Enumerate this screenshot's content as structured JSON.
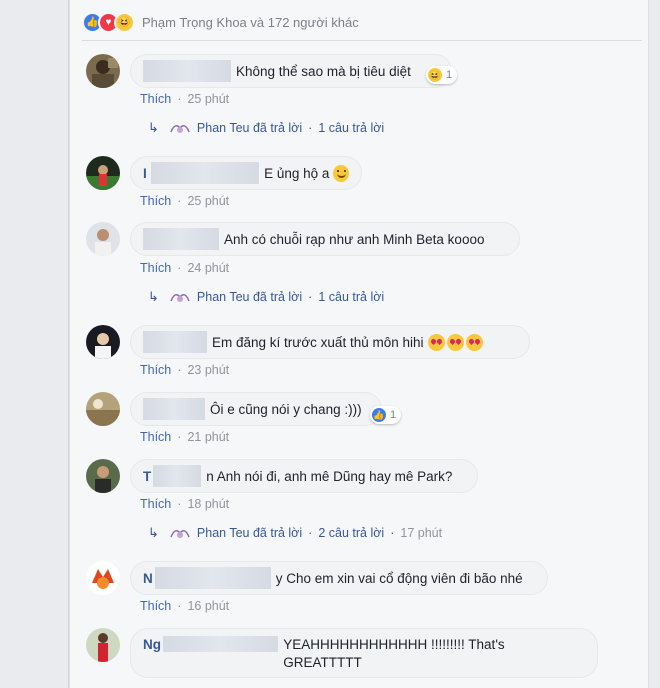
{
  "reactions": {
    "names": "Phạm Trọng Khoa và 172 người khác",
    "icons": [
      "like-icon",
      "love-icon",
      "haha-icon"
    ]
  },
  "labels": {
    "like": "Thích",
    "separator": "·",
    "reply_author_text": "Phan Teu đã trả lời",
    "reply_icon": "reply-arrow-icon"
  },
  "comments": [
    {
      "author": "",
      "text": "Không thể sao mà bị tiêu diệt",
      "time": "25 phút",
      "reaction_count": "1",
      "reaction_icon": "haha-icon",
      "reply_count": "1 câu trả lời"
    },
    {
      "author": "I",
      "text": "E ủng hộ a",
      "time": "25 phút",
      "emoji": "smile-emoji"
    },
    {
      "author": "",
      "text": "Anh có chuỗi rạp như anh Minh Beta koooo",
      "time": "24 phút",
      "reply_count": "1 câu trả lời"
    },
    {
      "author": "",
      "text": "Em đăng kí trước xuất thủ môn hihi",
      "time": "23 phút",
      "emoji": "heart-eyes-emoji"
    },
    {
      "author": "",
      "text": "Ôi e cũng nói y chang :)))",
      "time": "21 phút",
      "reaction_count": "1",
      "reaction_icon": "like-icon"
    },
    {
      "author": "T",
      "text": "n Anh nói đi, anh mê Dũng hay mê Park?",
      "time": "18 phút",
      "reply_count": "2 câu trả lời",
      "reply_time": "17 phút"
    },
    {
      "author": "N",
      "text": "y Cho em xin vai cổ động viên đi bão nhé",
      "time": "16 phút"
    },
    {
      "author": "Ng",
      "text": "YEAHHHHHHHHHHHH !!!!!!!!! That's GREATTTTT"
    }
  ],
  "colors": {
    "link": "#365899",
    "like_blue": "#4267b2",
    "meta_gray": "#90949c"
  }
}
